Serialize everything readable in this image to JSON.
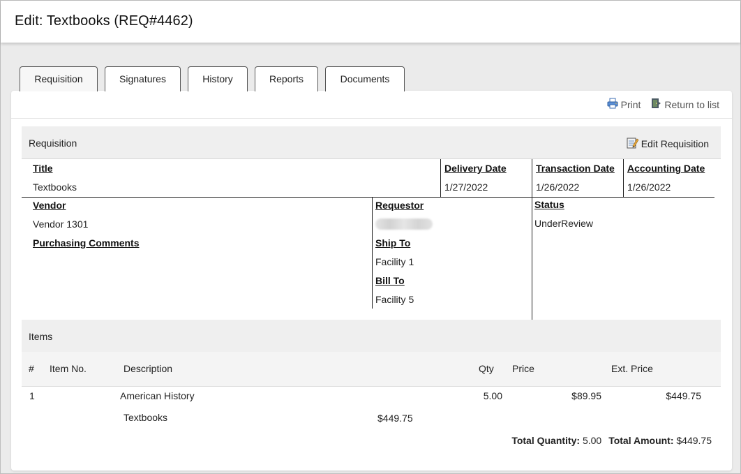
{
  "page": {
    "title": "Edit: Textbooks (REQ#4462)"
  },
  "tabs": [
    "Requisition",
    "Signatures",
    "History",
    "Reports",
    "Documents"
  ],
  "actions": {
    "print": "Print",
    "return": "Return to list"
  },
  "requisition": {
    "section_label": "Requisition",
    "edit_label": "Edit Requisition",
    "title_label": "Title",
    "title_value": "Textbooks",
    "delivery_label": "Delivery Date",
    "delivery_value": "1/27/2022",
    "transaction_label": "Transaction Date",
    "transaction_value": "1/26/2022",
    "accounting_label": "Accounting Date",
    "accounting_value": "1/26/2022",
    "vendor_label": "Vendor",
    "vendor_value": "Vendor 1301",
    "requestor_label": "Requestor",
    "status_label": "Status",
    "status_value": "UnderReview",
    "comments_label": "Purchasing Comments",
    "ship_label": "Ship To",
    "ship_value": "Facility 1",
    "bill_label": "Bill To",
    "bill_value": "Facility 5"
  },
  "items": {
    "section_label": "Items",
    "headers": {
      "num": "#",
      "item_no": "Item No.",
      "description": "Description",
      "qty": "Qty",
      "price": "Price",
      "ext_price": "Ext. Price"
    },
    "rows": [
      {
        "num": "1",
        "description": "American History",
        "qty": "5.00",
        "price": "$89.95",
        "ext_price": "$449.75"
      }
    ],
    "group": {
      "label": "Textbooks",
      "amount": "$449.75"
    },
    "totals": {
      "qty_label": "Total Quantity:",
      "qty_value": "5.00",
      "amount_label": "Total Amount:",
      "amount_value": "$449.75"
    }
  }
}
